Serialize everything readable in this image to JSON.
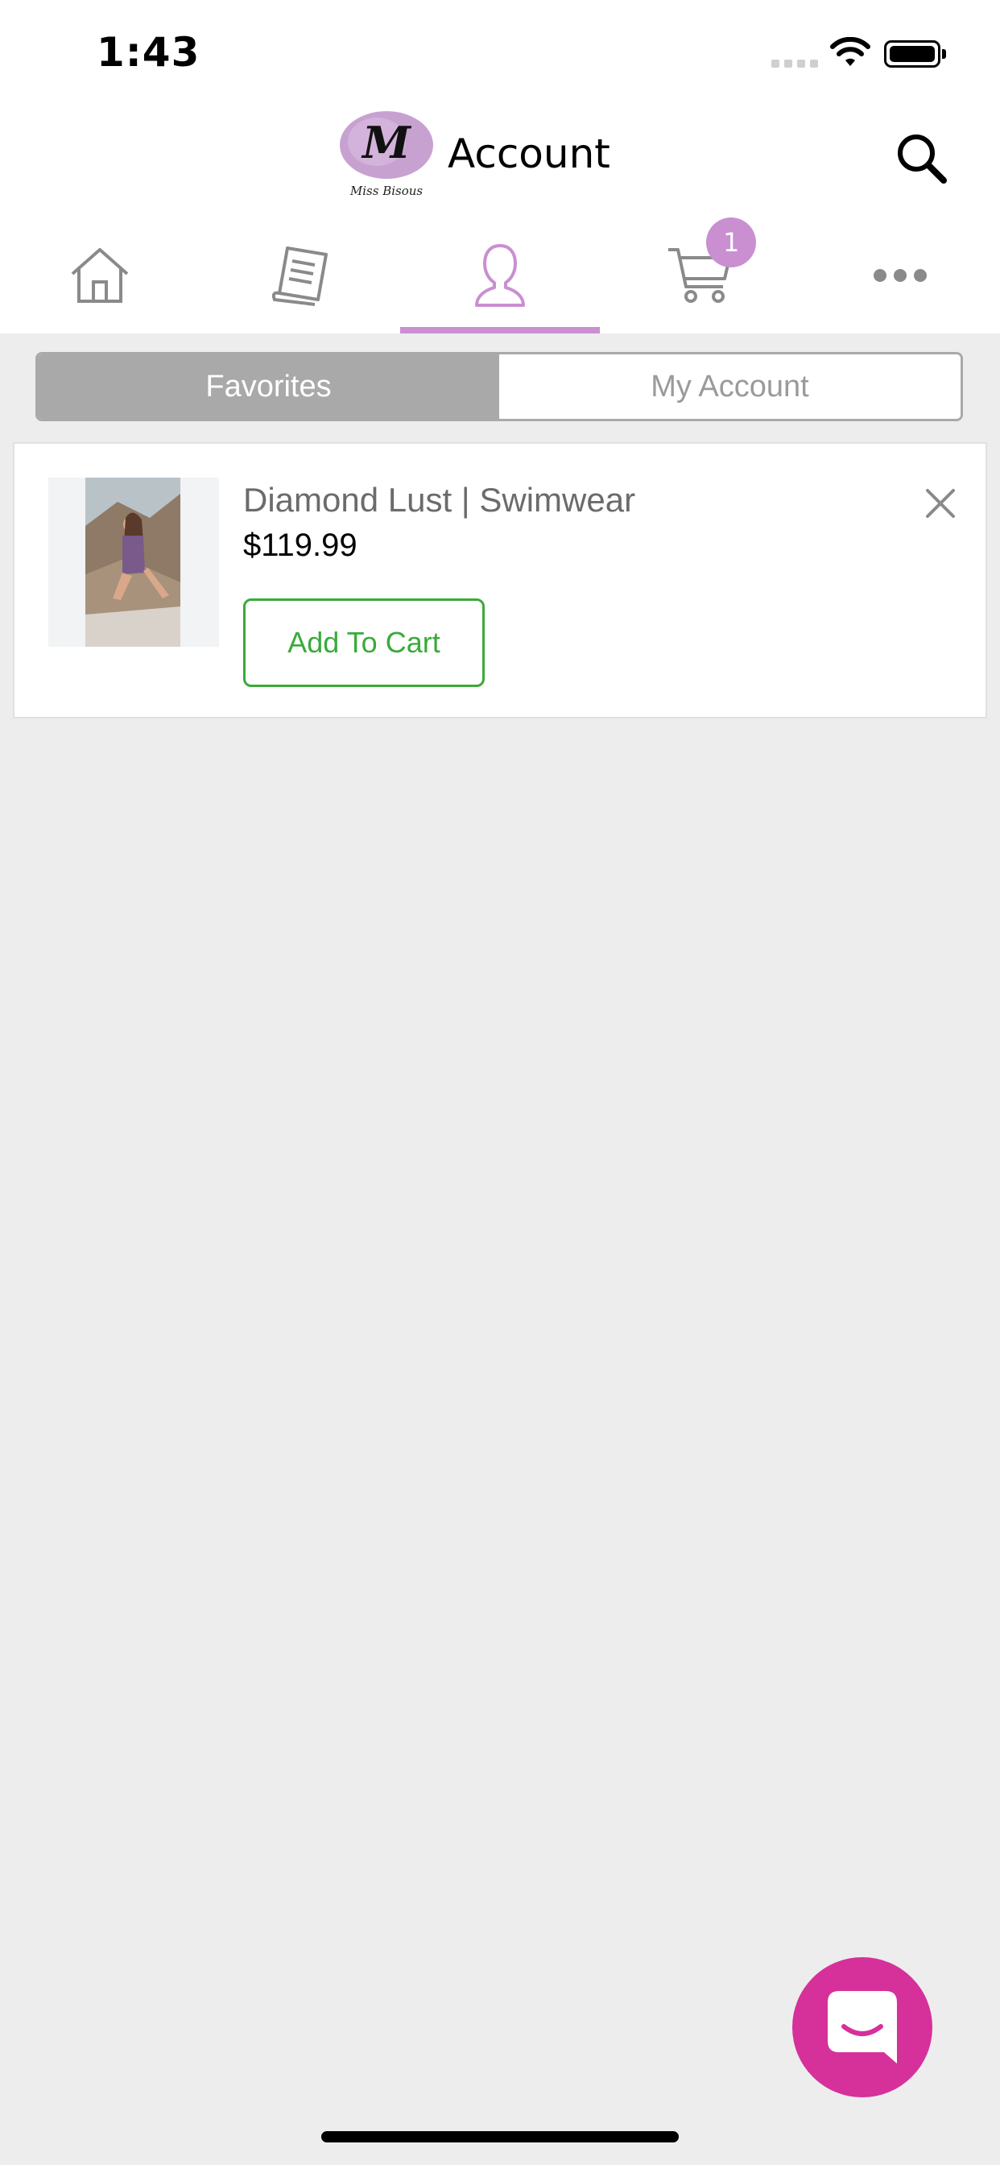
{
  "status_bar": {
    "time": "1:43"
  },
  "header": {
    "logo_text": "M",
    "logo_subtext": "Miss Bisous",
    "title": "Account"
  },
  "tabs": [
    {
      "name": "home",
      "icon": "home-icon",
      "active": false
    },
    {
      "name": "news",
      "icon": "document-icon",
      "active": false
    },
    {
      "name": "account",
      "icon": "user-icon",
      "active": true
    },
    {
      "name": "cart",
      "icon": "cart-icon",
      "active": false,
      "badge": "1"
    },
    {
      "name": "more",
      "icon": "more-icon",
      "active": false
    }
  ],
  "segmented": {
    "favorites": "Favorites",
    "my_account": "My Account",
    "selected": "Favorites"
  },
  "favorites": [
    {
      "name": "Diamond Lust | Swimwear",
      "price": "$119.99",
      "button": "Add To Cart"
    }
  ],
  "colors": {
    "accent": "#c98fd1",
    "add_to_cart": "#3aaa3a",
    "chat_fab": "#d6309b",
    "segment_active": "#a9a9a9"
  }
}
